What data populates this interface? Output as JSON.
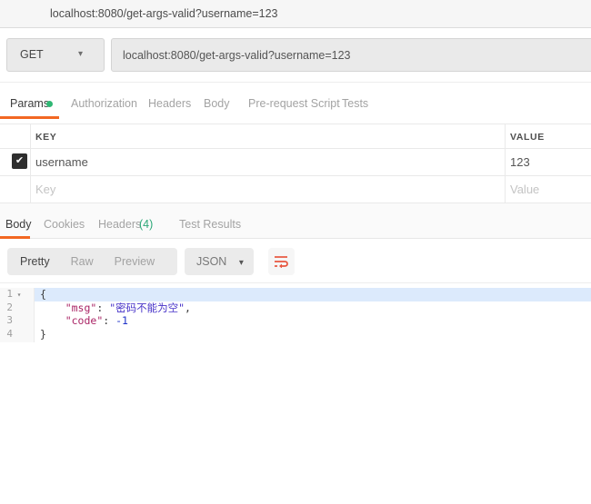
{
  "colors": {
    "accent_orange": "#f26722",
    "green_dot": "#2fb774",
    "headers_count_green": "#2ca878",
    "json_key": "#aa2465",
    "json_string": "#4632c8",
    "json_number": "#2134c9",
    "active_line_highlight": "#dceafc"
  },
  "icons": {
    "caret_down": "▾",
    "check": "✔"
  },
  "topbar": {
    "title": "localhost:8080/get-args-valid?username=123"
  },
  "request": {
    "method": "GET",
    "url": "localhost:8080/get-args-valid?username=123",
    "tabs": [
      {
        "label": "Params"
      },
      {
        "label": "Authorization"
      },
      {
        "label": "Headers"
      },
      {
        "label": "Body"
      },
      {
        "label": "Pre-request Script"
      },
      {
        "label": "Tests"
      }
    ]
  },
  "params_table": {
    "headers": {
      "key": "KEY",
      "value": "VALUE"
    },
    "rows": [
      {
        "key": "username",
        "value": "123",
        "checked": true
      }
    ],
    "placeholder_row": {
      "key": "Key",
      "value": "Value"
    }
  },
  "response": {
    "tabs": {
      "body": "Body",
      "cookies": "Cookies",
      "headers": "Headers",
      "headers_count": "(4)",
      "test_results": "Test Results"
    },
    "view_modes": {
      "pretty": "Pretty",
      "raw": "Raw",
      "preview": "Preview"
    },
    "format": {
      "label": "JSON"
    }
  },
  "response_body": {
    "lines": [
      {
        "no": "1",
        "open": "{"
      },
      {
        "no": "2",
        "indent": "    ",
        "key": "\"msg\"",
        "sep": ": ",
        "value": "\"密码不能为空\"",
        "comma": ","
      },
      {
        "no": "3",
        "indent": "    ",
        "key": "\"code\"",
        "sep": ": ",
        "value": "-1"
      },
      {
        "no": "4",
        "close": "}"
      }
    ]
  }
}
